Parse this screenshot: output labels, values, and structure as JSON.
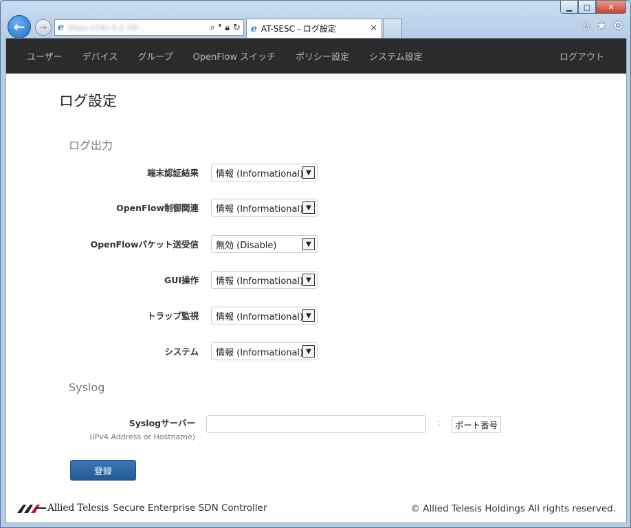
{
  "window": {
    "caption": {
      "minimize": "▁",
      "maximize": "□",
      "close": "✕"
    },
    "tab_title": "AT-SESC - ログ設定",
    "address_url": "https://192.0.2.18/...",
    "icons": [
      "back-arrow-icon",
      "forward-arrow-icon",
      "ie-logo-icon",
      "search-icon",
      "lock-icon",
      "refresh-icon",
      "home-icon",
      "favorites-star-icon",
      "settings-gear-icon"
    ]
  },
  "navbar": {
    "items": [
      "ユーザー",
      "デバイス",
      "グループ",
      "OpenFlow スイッチ",
      "ポリシー設定",
      "システム設定"
    ],
    "logout": "ログアウト"
  },
  "page": {
    "title": "ログ設定",
    "log_output": {
      "section_title": "ログ出力",
      "fields": [
        {
          "label": "端末認証結果",
          "value": "情報 (Informational)"
        },
        {
          "label": "OpenFlow制御関連",
          "value": "情報 (Informational)"
        },
        {
          "label": "OpenFlowパケット送受信",
          "value": "無効 (Disable)"
        },
        {
          "label": "GUI操作",
          "value": "情報 (Informational)"
        },
        {
          "label": "トラップ監視",
          "value": "情報 (Informational)"
        },
        {
          "label": "システム",
          "value": "情報 (Informational)"
        }
      ]
    },
    "syslog": {
      "section_title": "Syslog",
      "server_label": "Syslogサーバー",
      "server_hint": "(IPv4 Address or Hostname)",
      "server_value": "",
      "colon": ":",
      "port_placeholder": "ポート番号"
    },
    "submit": "登録"
  },
  "footer": {
    "brand": "Allied Telesis",
    "product": "Secure Enterprise SDN Controller",
    "copyright": "© Allied Telesis Holdings All rights reserved."
  },
  "colors": {
    "navbar_bg": "#2b2b2b",
    "primary_button": "#2d66a8",
    "nav_text": "#b8b8b8"
  }
}
